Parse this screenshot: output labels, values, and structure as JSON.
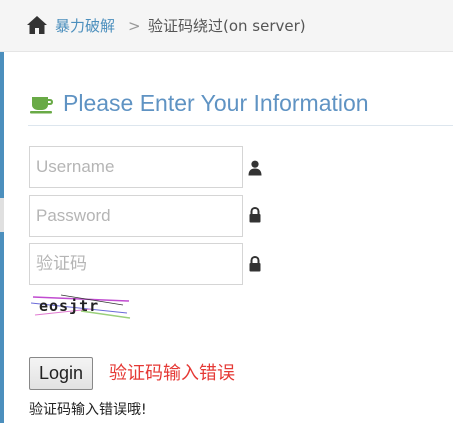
{
  "breadcrumb": {
    "home_icon": "home-icon",
    "link_label": "暴力破解",
    "separator": ">",
    "current_label": "验证码绕过(on server)"
  },
  "form": {
    "title": "Please Enter Your Information",
    "title_icon": "coffee-icon",
    "username": {
      "value": "",
      "placeholder": "Username",
      "icon": "user-icon"
    },
    "password": {
      "value": "",
      "placeholder": "Password",
      "icon": "lock-icon"
    },
    "captcha_input": {
      "value": "",
      "placeholder": "验证码",
      "icon": "lock-icon"
    },
    "captcha_image_text": "eosjtr",
    "login_label": "Login",
    "inline_error": "验证码输入错误",
    "error_message": "验证码输入错误哦!"
  },
  "colors": {
    "accent": "#4c8fbd",
    "title": "#5f93c3",
    "error": "#e53935",
    "icon_dark": "#333333"
  }
}
